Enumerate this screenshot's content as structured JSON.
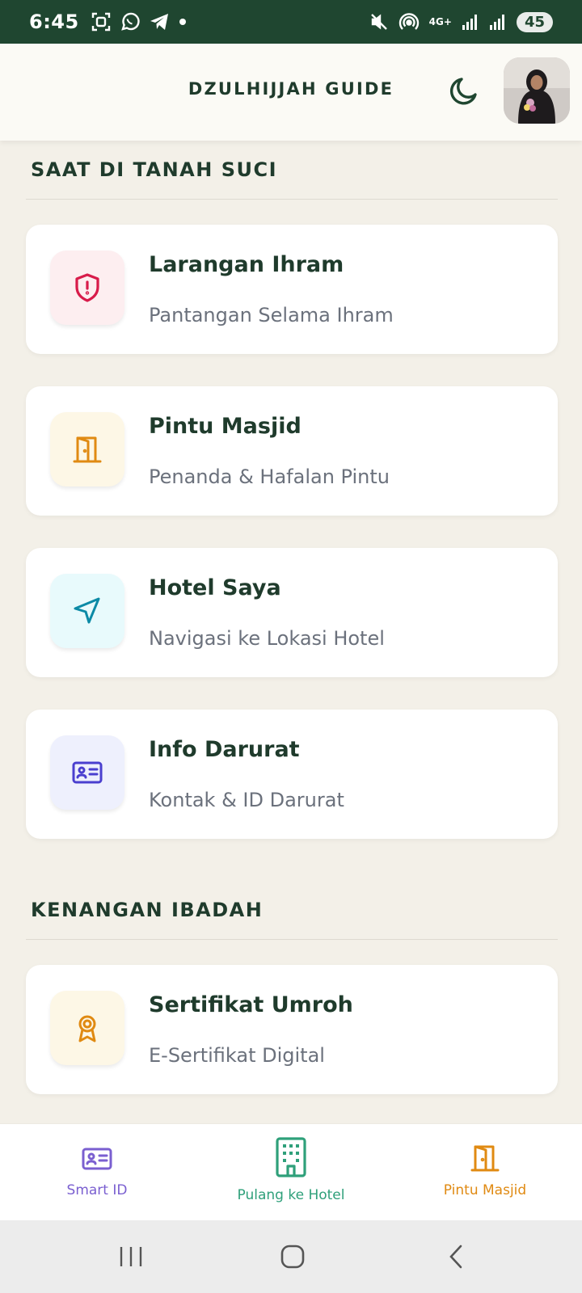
{
  "status_bar": {
    "time": "6:45",
    "network": "4G+",
    "battery": "45"
  },
  "header": {
    "title": "DZULHIJJAH GUIDE"
  },
  "sections": [
    {
      "title": "SAAT DI TANAH SUCI",
      "cards": [
        {
          "title": "Larangan Ihram",
          "subtitle": "Pantangan Selama Ihram",
          "icon": "shield-alert-icon",
          "icon_color": "#d81b4a",
          "icon_bg": "#fdeef0"
        },
        {
          "title": "Pintu Masjid",
          "subtitle": "Penanda & Hafalan Pintu",
          "icon": "door-icon",
          "icon_color": "#e08a12",
          "icon_bg": "#fdf7e6"
        },
        {
          "title": "Hotel Saya",
          "subtitle": "Navigasi ke Lokasi Hotel",
          "icon": "navigation-arrow-icon",
          "icon_color": "#0c8aa6",
          "icon_bg": "#e8fafc"
        },
        {
          "title": "Info Darurat",
          "subtitle": "Kontak & ID Darurat",
          "icon": "id-card-icon",
          "icon_color": "#4a3fcf",
          "icon_bg": "#eef0fd"
        }
      ]
    },
    {
      "title": "KENANGAN IBADAH",
      "cards": [
        {
          "title": "Sertifikat Umroh",
          "subtitle": "E-Sertifikat Digital",
          "icon": "award-ribbon-icon",
          "icon_color": "#e08a12",
          "icon_bg": "#fdf7e6"
        }
      ]
    }
  ],
  "bottom_nav": [
    {
      "label": "Smart ID",
      "icon": "id-card-icon",
      "color": "#7a5fd0"
    },
    {
      "label": "Pulang ke Hotel",
      "icon": "building-icon",
      "color": "#2fa07a"
    },
    {
      "label": "Pintu Masjid",
      "icon": "door-icon",
      "color": "#e08a12"
    }
  ]
}
